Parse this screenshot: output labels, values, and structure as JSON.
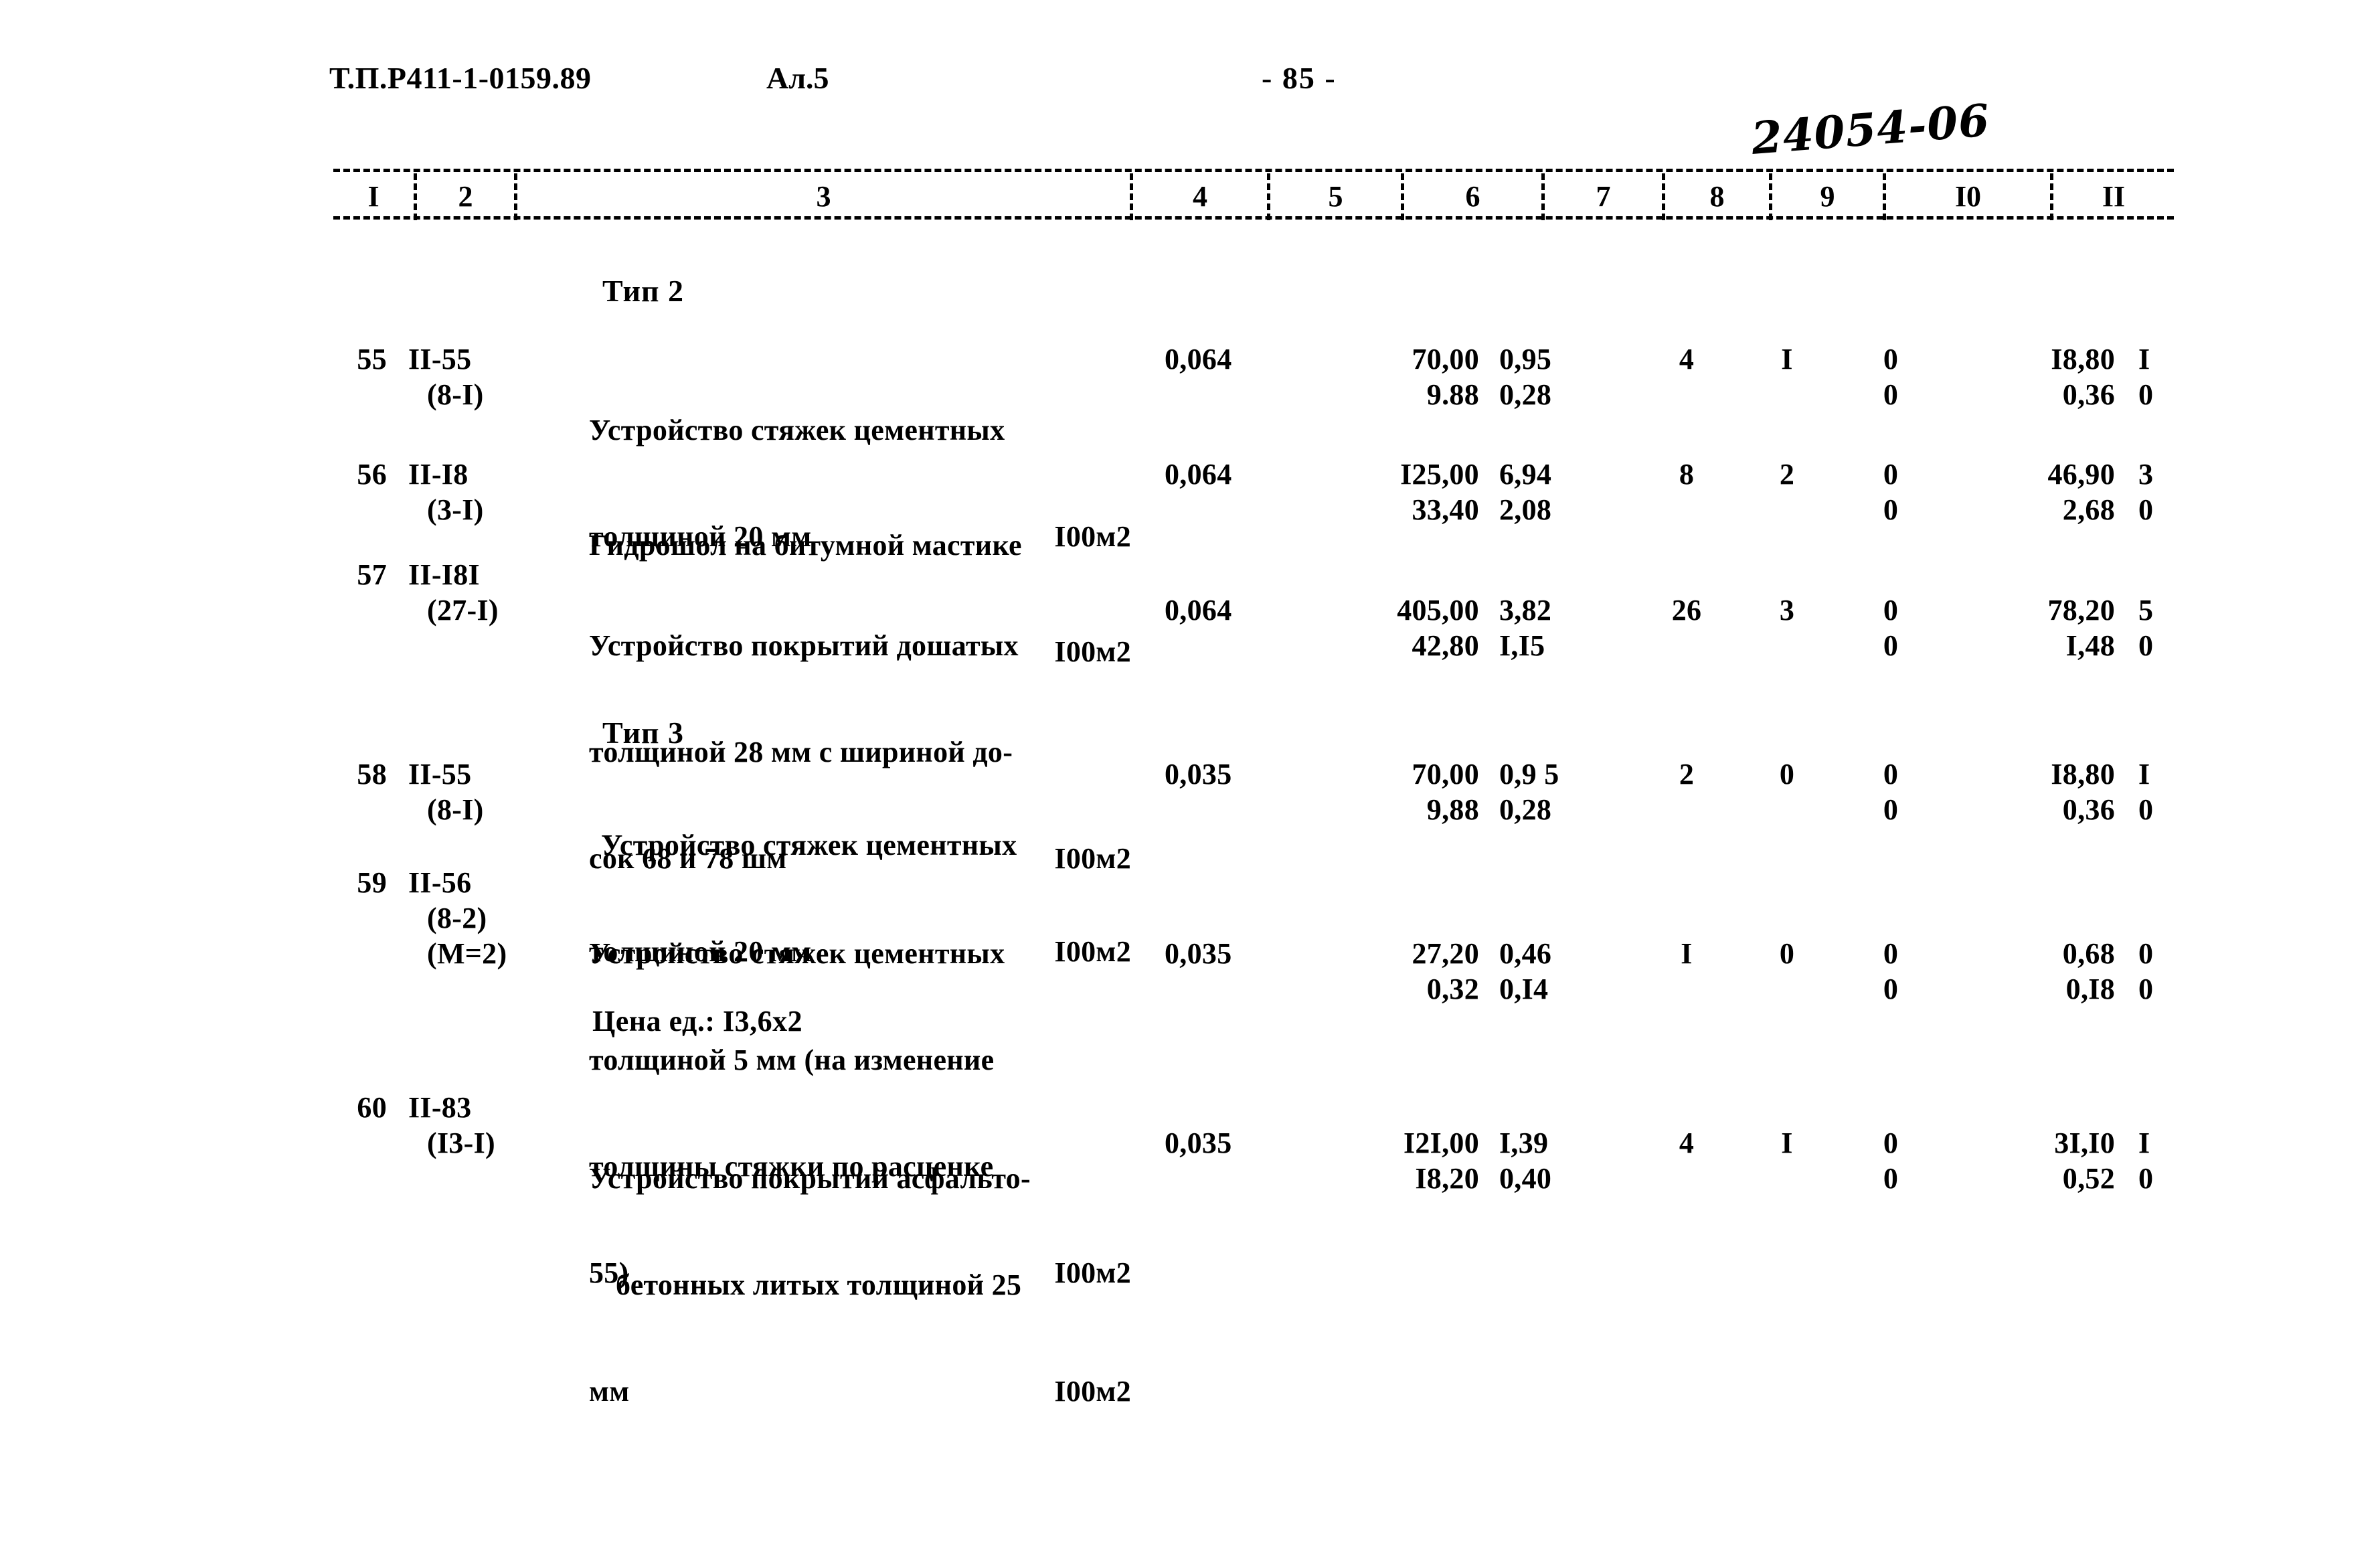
{
  "header": {
    "doc_code": "Т.П.Р411-1-0159.89",
    "album": "Ал.5",
    "page_number": "- 85 -",
    "hand_note": "24054-06"
  },
  "table": {
    "column_numbers": [
      "I",
      "2",
      "3",
      "4",
      "5",
      "6",
      "7",
      "8",
      "9",
      "I0",
      "II"
    ],
    "sections": [
      {
        "caption": "Тип 2"
      },
      {
        "caption": "Тип 3"
      }
    ],
    "rows": [
      {
        "num": "55",
        "code_line1": "II-55",
        "code_line2": "(8-I)",
        "desc_lines": [
          "Устройство стяжек цементных",
          "толщиной 20 мм"
        ],
        "unit": "I00м2",
        "qty": "0,064",
        "col5_top": "70,00",
        "col5_bottom": "9.88",
        "col6_top": "0,95",
        "col6_bottom": "0,28",
        "col7": "4",
        "col8": "I",
        "col9_top": "0",
        "col9_bottom": "0",
        "col10_top": "I8,80",
        "col10_bottom": "0,36",
        "col11_top": "I",
        "col11_bottom": "0"
      },
      {
        "num": "56",
        "code_line1": "II-I8",
        "code_line2": "(3-I)",
        "desc_lines": [
          "Гидрошол на битумной мастике",
          ""
        ],
        "unit": "I00м2",
        "qty": "0,064",
        "col5_top": "I25,00",
        "col5_bottom": "33,40",
        "col6_top": "6,94",
        "col6_bottom": "2,08",
        "col7": "8",
        "col8": "2",
        "col9_top": "0",
        "col9_bottom": "0",
        "col10_top": "46,90",
        "col10_bottom": "2,68",
        "col11_top": "3",
        "col11_bottom": "0"
      },
      {
        "num": "57",
        "code_line1": "II-I8I",
        "code_line2": "(27-I)",
        "desc_lines": [
          "Устройство покрытий дошатых",
          "толщиной 28 мм с шириной до-",
          "сок 68 и 78 шм"
        ],
        "unit": "I00м2",
        "qty": "0,064",
        "col5_top": "405,00",
        "col5_bottom": "42,80",
        "col6_top": "3,82",
        "col6_bottom": "I,I5",
        "col7": "26",
        "col8": "3",
        "col9_top": "0",
        "col9_bottom": "0",
        "col10_top": "78,20",
        "col10_bottom": "I,48",
        "col11_top": "5",
        "col11_bottom": "0"
      },
      {
        "num": "58",
        "code_line1": "II-55",
        "code_line2": "(8-I)",
        "desc_lines": [
          "Устройство стяжек цементных",
          "толщиной 20 мм"
        ],
        "unit": "I00м2",
        "qty": "0,035",
        "col5_top": "70,00",
        "col5_bottom": "9,88",
        "col6_top": "0,9 5",
        "col6_bottom": "0,28",
        "col7": "2",
        "col8": "0",
        "col9_top": "0",
        "col9_bottom": "0",
        "col10_top": "I8,80",
        "col10_bottom": "0,36",
        "col11_top": "I",
        "col11_bottom": "0"
      },
      {
        "num": "59",
        "code_line1": "II-56",
        "code_line2": "(8-2)",
        "code_line3": "(М=2)",
        "desc_lines": [
          "Устройство стяжек цементных",
          "толщиной 5 мм (на изменение",
          "толщины стяжки по расценке",
          "55)"
        ],
        "unit": "I00м2",
        "qty": "0,035",
        "col5_top": "27,20",
        "col5_bottom": "0,32",
        "col6_top": "0,46",
        "col6_bottom": "0,I4",
        "col7": "I",
        "col8": "0",
        "col9_top": "0",
        "col9_bottom": "0",
        "col10_top": "0,68",
        "col10_bottom": "0,I8",
        "col11_top": "0",
        "col11_bottom": "0",
        "note": "Цена ед.: I3,6x2"
      },
      {
        "num": "60",
        "code_line1": "II-83",
        "code_line2": "(I3-I)",
        "desc_lines": [
          "Устройство покрытий асфальто-",
          "бетонных литых толщиной 25",
          "мм"
        ],
        "unit": "I00м2",
        "qty": "0,035",
        "col5_top": "I2I,00",
        "col5_bottom": "I8,20",
        "col6_top": "I,39",
        "col6_bottom": "0,40",
        "col7": "4",
        "col8": "I",
        "col9_top": "0",
        "col9_bottom": "0",
        "col10_top": "3I,I0",
        "col10_bottom": "0,52",
        "col11_top": "I",
        "col11_bottom": "0"
      }
    ]
  }
}
